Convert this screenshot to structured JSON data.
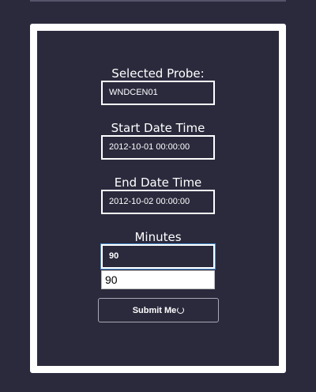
{
  "form": {
    "probe_label": "Selected Probe:",
    "probe_value": "WNDCEN01",
    "start_label": "Start Date Time",
    "start_value": "2012-10-01 00:00:00",
    "end_label": "End Date Time",
    "end_value": "2012-10-02 00:00:00",
    "minutes_label": "Minutes",
    "minutes_value": "90",
    "minutes_suggestion": "90",
    "submit_label": "Submit Me"
  },
  "colors": {
    "background": "#2b2a3d",
    "panel_border": "#ffffff",
    "focus_ring": "#4a90d9"
  }
}
